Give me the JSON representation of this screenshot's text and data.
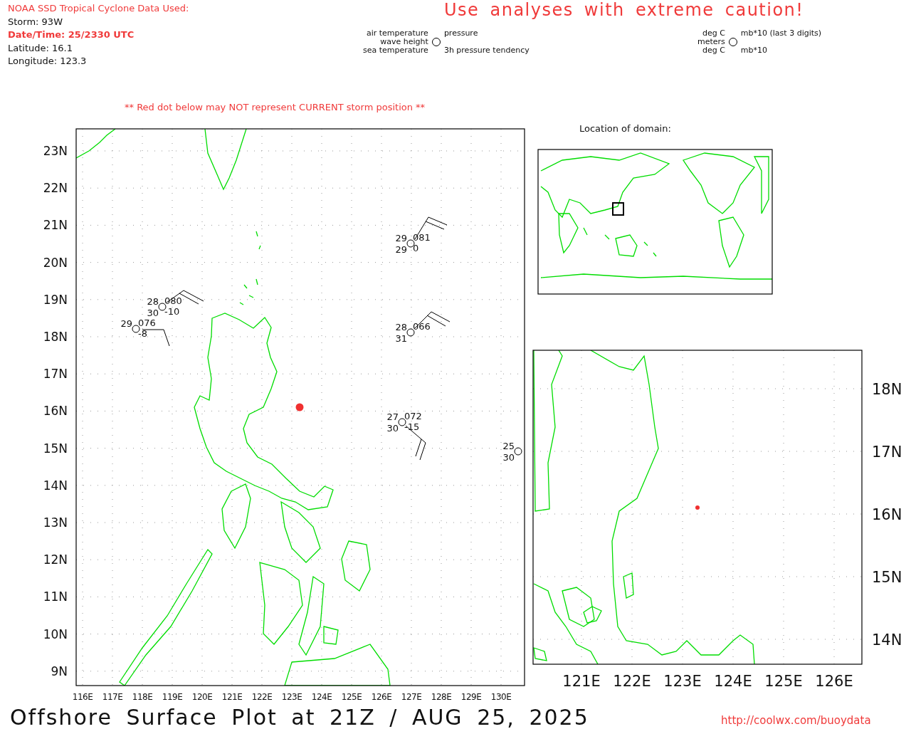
{
  "header": {
    "source_title": "NOAA SSD Tropical Cyclone Data Used:",
    "storm": "Storm: 93W",
    "datetime": "Date/Time: 25/2330 UTC",
    "latitude": "Latitude: 16.1",
    "longitude": "Longitude: 123.3"
  },
  "caution": "Use analyses with extreme caution!",
  "legend": {
    "left": [
      "air temperature",
      "wave height",
      "sea temperature"
    ],
    "right": [
      "pressure",
      "3h pressure tendency"
    ],
    "units_left": [
      "deg C",
      "meters",
      "deg C"
    ],
    "units_right": [
      "mb*10 (last 3 digits)",
      "mb*10"
    ]
  },
  "warning": "** Red dot below may NOT represent CURRENT storm position **",
  "main_map": {
    "lat_labels": [
      "23N",
      "22N",
      "21N",
      "20N",
      "19N",
      "18N",
      "17N",
      "16N",
      "15N",
      "14N",
      "13N",
      "12N",
      "11N",
      "10N",
      "9N"
    ],
    "lon_labels": [
      "116E",
      "117E",
      "118E",
      "119E",
      "120E",
      "121E",
      "122E",
      "123E",
      "124E",
      "125E",
      "126E",
      "127E",
      "128E",
      "129E",
      "130E"
    ],
    "stations": [
      {
        "air": "29",
        "pressure": "081",
        "sea": "29",
        "tendency": "0"
      },
      {
        "air": "28",
        "pressure": "080",
        "sea": "30",
        "tendency": "-10"
      },
      {
        "air": "29",
        "pressure": "076",
        "tendency": "-8"
      },
      {
        "air": "28",
        "pressure": "066",
        "sea": "31"
      },
      {
        "air": "27",
        "pressure": "072",
        "sea": "30",
        "tendency": "-15"
      },
      {
        "air": "25",
        "sea": "30"
      }
    ]
  },
  "domain_map": {
    "title": "Location of domain:"
  },
  "zoom_map": {
    "lat_labels": [
      "18N",
      "17N",
      "16N",
      "15N",
      "14N"
    ],
    "lon_labels": [
      "121E",
      "122E",
      "123E",
      "124E",
      "125E",
      "126E"
    ]
  },
  "footer": {
    "title": "Offshore Surface Plot at 21Z / AUG 25, 2025",
    "url": "http://coolwx.com/buoydata"
  }
}
